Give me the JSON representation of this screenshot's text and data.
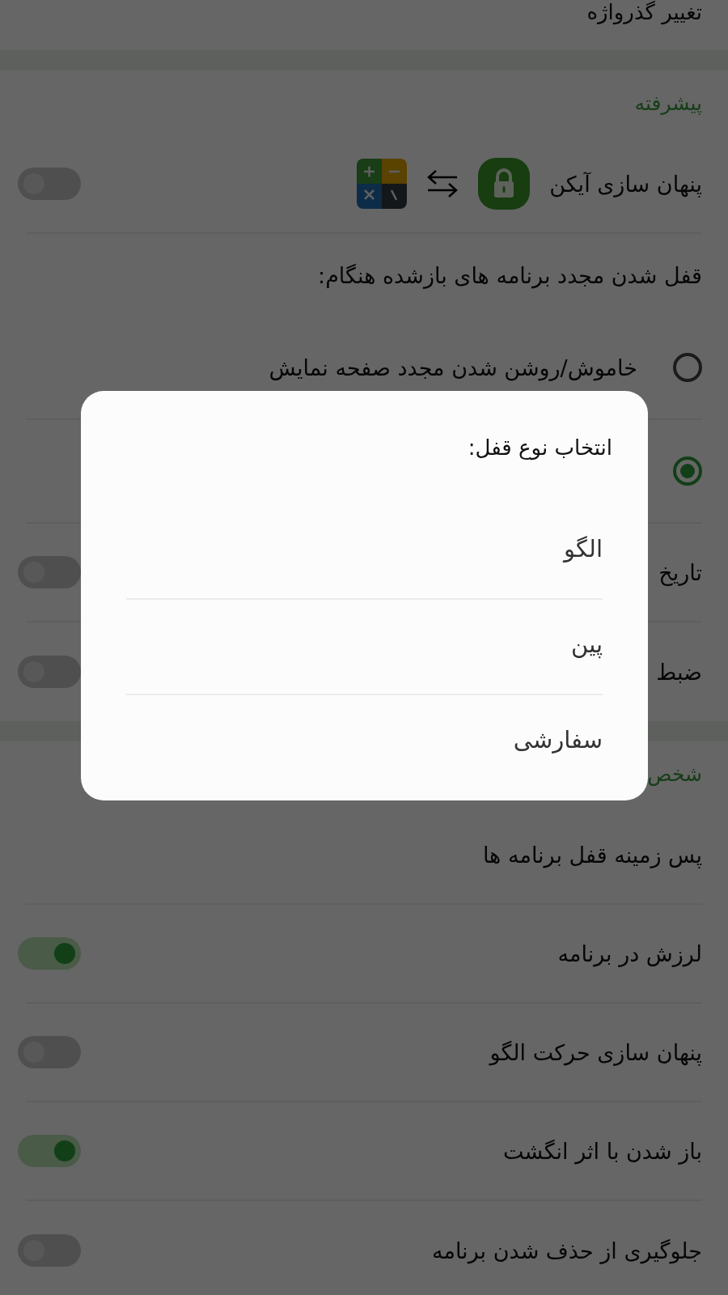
{
  "top_item": {
    "label": "تغییر گذرواژه"
  },
  "sections": [
    {
      "title": "پیشرفته",
      "rows": [
        {
          "kind": "icon_toggle",
          "label": "پنهان سازی آیکن",
          "on": false
        },
        {
          "kind": "heading",
          "label": "قفل شدن مجدد برنامه های بازشده هنگام:"
        },
        {
          "kind": "radio",
          "label": "خاموش/روشن شدن مجدد صفحه نمایش",
          "selected": false
        },
        {
          "kind": "radio",
          "selected": true
        },
        {
          "kind": "toggle",
          "label": "تاریخ",
          "on": false
        },
        {
          "kind": "toggle",
          "label": "ضبط",
          "on": false
        }
      ]
    },
    {
      "title": "شخص",
      "rows": [
        {
          "kind": "link",
          "label": "پس زمینه قفل برنامه ها"
        },
        {
          "kind": "toggle",
          "label": "لرزش در برنامه",
          "on": true
        },
        {
          "kind": "toggle",
          "label": "پنهان سازی حرکت الگو",
          "on": false
        },
        {
          "kind": "toggle",
          "label": "باز شدن با اثر انگشت",
          "on": true
        },
        {
          "kind": "toggle",
          "label": "جلوگیری از حذف شدن برنامه",
          "on": false
        }
      ]
    }
  ],
  "dialog": {
    "title": "انتخاب نوع قفل:",
    "options": [
      "الگو",
      "پین",
      "سفارشی"
    ]
  }
}
